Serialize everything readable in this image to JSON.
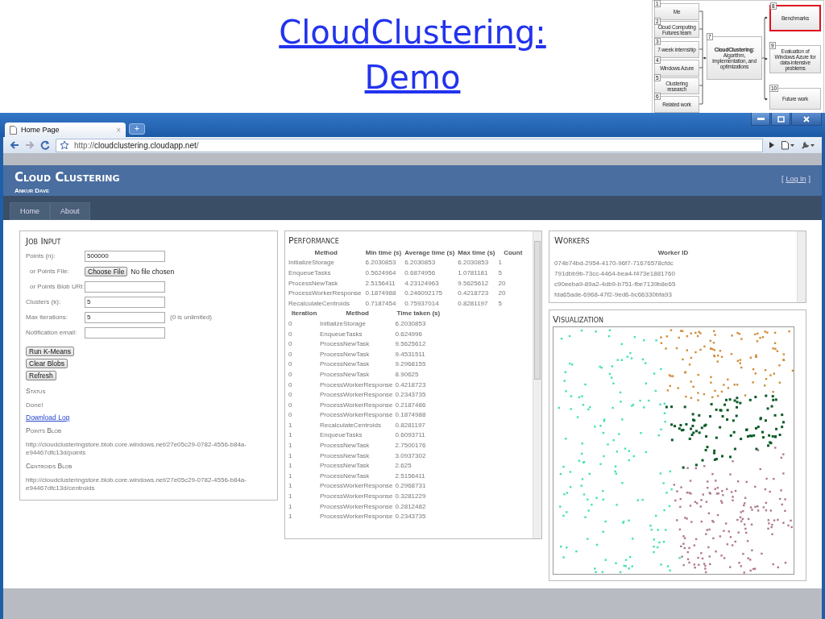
{
  "slide": {
    "title": "CloudClustering: Demo"
  },
  "outline_diagram": {
    "left_nodes": [
      {
        "number": "1",
        "label": "Me"
      },
      {
        "number": "2",
        "label": "Cloud Computing Futures team"
      },
      {
        "number": "3",
        "label": "7-week internship"
      },
      {
        "number": "4",
        "label": "Windows Azure"
      },
      {
        "number": "5",
        "label": "Clustering research"
      },
      {
        "number": "6",
        "label": "Related work"
      }
    ],
    "center_node": {
      "number": "7",
      "label": "**CloudClustering:** Algorithm, implementation, and optimizations"
    },
    "right_nodes": [
      {
        "number": "8",
        "label": "Benchmarks",
        "selected": true
      },
      {
        "number": "9",
        "label": "Evaluation of Windows Azure for data-intensive problems",
        "selected": false
      },
      {
        "number": "10",
        "label": "Future work",
        "selected": false
      }
    ]
  },
  "browser": {
    "tab": {
      "title": "Home Page",
      "close": "×"
    },
    "new_tab": "+",
    "url_scheme": "http://",
    "url_host": "cloudclustering.cloudapp.net",
    "url_path": "/"
  },
  "site": {
    "title": "Cloud Clustering",
    "subtitle": "Ankur Dave",
    "login": {
      "open": "[",
      "link": "Log In",
      "close": "]"
    },
    "nav": [
      "Home",
      "About"
    ]
  },
  "job_input": {
    "heading": "Job Input",
    "fields": [
      {
        "kind": "text",
        "label": "Points (n):",
        "indented": false,
        "value": "500000"
      },
      {
        "kind": "file",
        "label": "or Points File:",
        "indented": true,
        "button": "Choose File",
        "note": "No file chosen"
      },
      {
        "kind": "text",
        "label": "or Points Blob URI:",
        "indented": true
      },
      {
        "kind": "text",
        "label": "Clusters (k):",
        "indented": false,
        "value": "5"
      },
      {
        "kind": "text",
        "label": "Max iterations:",
        "indented": false,
        "value": "5",
        "hint": "(0 is unlimited)"
      },
      {
        "kind": "text",
        "label": "Notification email:",
        "indented": false
      }
    ],
    "buttons": [
      "Run K-Means",
      "Clear Blobs",
      "Refresh"
    ],
    "status_heading": "Status",
    "status": "Done!",
    "log_link": "Download Log",
    "points_heading": "Points Blob",
    "points_url": "http://cloudclusteringstore.blob.core.windows.net/27e05c29-0782-4556-b84a-e94467dfc13d/points",
    "centroids_heading": "Centroids Blob",
    "centroids_url": "http://cloudclusteringstore.blob.core.windows.net/27e05c29-0782-4556-b84a-e94467dfc13d/centroids"
  },
  "performance": {
    "heading": "Performance",
    "summary": {
      "columns": [
        "Method",
        "Min time (s)",
        "Average time (s)",
        "Max time (s)",
        "Count"
      ],
      "rows": [
        [
          "InitializeStorage",
          "6.2030853",
          "6.2030853",
          "6.2030853",
          "1"
        ],
        [
          "EnqueueTasks",
          "0.5624964",
          "0.6874956",
          "1.0781181",
          "5"
        ],
        [
          "ProcessNewTask",
          "2.5156411",
          "4.23124963",
          "9.5625612",
          "20"
        ],
        [
          "ProcessWorkerResponse",
          "0.1874988",
          "0.246092175",
          "0.4218723",
          "20"
        ],
        [
          "RecalculateCentroids",
          "0.7187454",
          "0.75937014",
          "0.8281197",
          "5"
        ]
      ]
    },
    "iterations": {
      "columns": [
        "Iteration",
        "Method",
        "Time taken (s)"
      ],
      "rows": [
        [
          "0",
          "InitializeStorage",
          "6.2030853"
        ],
        [
          "0",
          "EnqueueTasks",
          "0.624996"
        ],
        [
          "0",
          "ProcessNewTask",
          "9.5625612"
        ],
        [
          "0",
          "ProcessNewTask",
          "9.4531511"
        ],
        [
          "0",
          "ProcessNewTask",
          "9.2968155"
        ],
        [
          "0",
          "ProcessNewTask",
          "8.90625"
        ],
        [
          "0",
          "ProcessWorkerResponse",
          "0.4218723"
        ],
        [
          "0",
          "ProcessWorkerResponse",
          "0.2343735"
        ],
        [
          "0",
          "ProcessWorkerResponse",
          "0.2187486"
        ],
        [
          "0",
          "ProcessWorkerResponse",
          "0.1874988"
        ],
        [
          "1",
          "RecalculateCentroids",
          "0.8281197"
        ],
        [
          "1",
          "EnqueueTasks",
          "0.6093711"
        ],
        [
          "1",
          "ProcessNewTask",
          "2.7500176"
        ],
        [
          "1",
          "ProcessNewTask",
          "3.0937302"
        ],
        [
          "1",
          "ProcessNewTask",
          "2.625"
        ],
        [
          "1",
          "ProcessNewTask",
          "2.5156411"
        ],
        [
          "1",
          "ProcessWorkerResponse",
          "0.2968731"
        ],
        [
          "1",
          "ProcessWorkerResponse",
          "0.3281229"
        ],
        [
          "1",
          "ProcessWorkerResponse",
          "0.2812482"
        ],
        [
          "1",
          "ProcessWorkerResponse",
          "0.2343735"
        ]
      ]
    }
  },
  "workers": {
    "heading": "Workers",
    "column": "Worker ID",
    "rows": [
      "074b74bd-2954-4170-96f7-71676578cfdc",
      "791dbb9b-73cc-4464-bea4-f473e1881760",
      "c90eeba9-89a2-4db9-b751-fbe7139b8e65",
      "fda65ade-6968-47f2-9ed6-bc66330bfa93"
    ]
  },
  "visualization": {
    "heading": "Visualization"
  }
}
